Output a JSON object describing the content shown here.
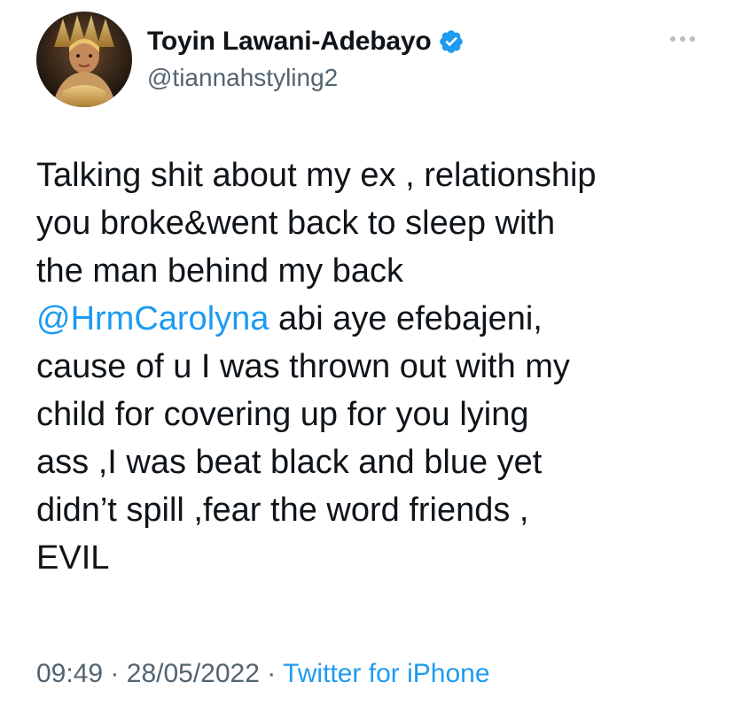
{
  "tweet": {
    "author": {
      "display_name": "Toyin Lawani-Adebayo",
      "handle": "@tiannahstyling2",
      "verified": true
    },
    "text_lines": [
      "Talking shit about my ex , relationship",
      "you broke&went back to sleep with",
      "the man behind my back",
      "abi aye efebajeni,",
      "cause of u I was thrown out with my",
      "child for covering up for you lying",
      "ass ,I was beat black and blue yet",
      "didn’t spill ,fear the word friends ,",
      "EVIL"
    ],
    "mention": "@HrmCarolyna",
    "time": "09:49",
    "date": "28/05/2022",
    "separator": "·",
    "source": "Twitter for iPhone"
  },
  "colors": {
    "text": "#0f1419",
    "secondary": "#536471",
    "link": "#1d9bf0",
    "verified": "#1d9bf0"
  },
  "icons": {
    "verified": "verified-badge-icon",
    "more": "more-options-icon"
  }
}
